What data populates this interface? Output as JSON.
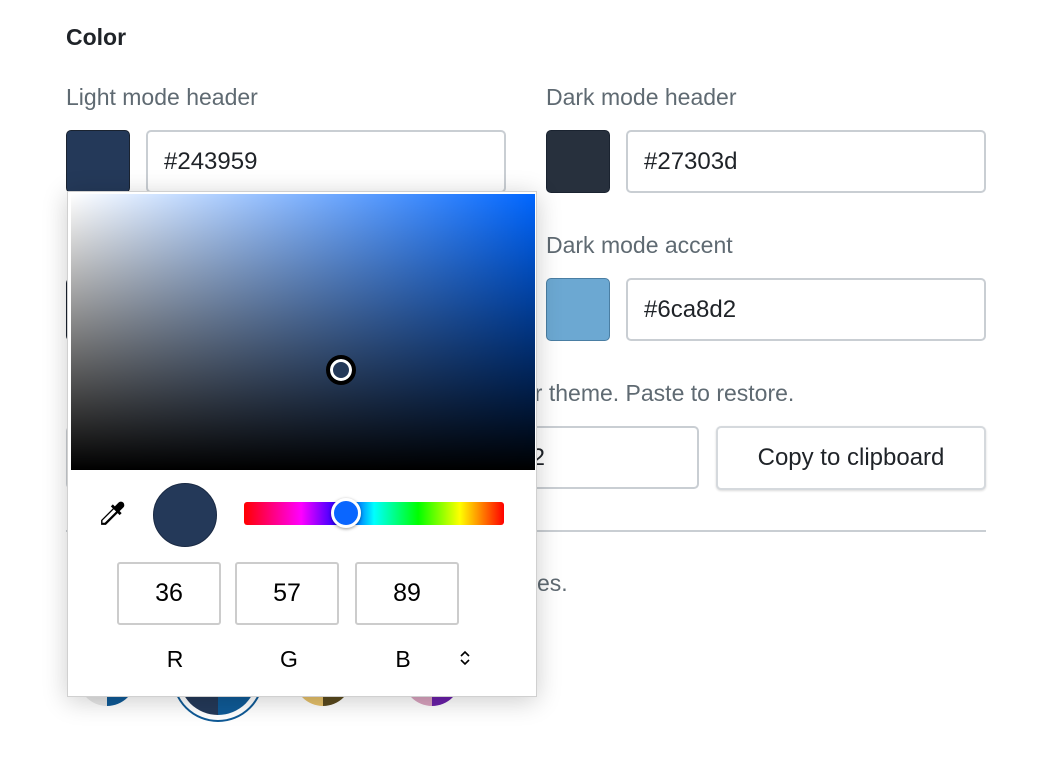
{
  "section_title": "Color",
  "light_header": {
    "label": "Light mode header",
    "value": "#243959",
    "color": "#243959"
  },
  "dark_header": {
    "label": "Dark mode header",
    "value": "#27303d",
    "color": "#27303d"
  },
  "dark_accent": {
    "label": "Dark mode accent",
    "value": "#6ca8d2",
    "color": "#6ca8d2"
  },
  "light_accent": {
    "color": "#0f5a96"
  },
  "theme_text_partial": "ur theme. Paste to restore.",
  "theme_input_partial": "2",
  "copy_button": "Copy to clipboard",
  "presets_text_partial": "es.",
  "picker": {
    "hue_color": "#0066ff",
    "selected_color": "#243959",
    "r": "36",
    "g": "57",
    "b": "89",
    "r_label": "R",
    "g_label": "G",
    "b_label": "B",
    "mode_toggle_icon": "chevron-up-down-icon",
    "eyedropper_icon": "eyedropper-icon"
  },
  "theme_presets": [
    {
      "colors": [
        "#e8e8e8",
        "#0f5a96"
      ]
    },
    {
      "colors": [
        "#243959",
        "#0f5a96"
      ],
      "selected": true
    },
    {
      "colors": [
        "#e5c06a",
        "#5a4a1e"
      ]
    },
    {
      "colors": [
        "#d9a3bf",
        "#6a1fa8"
      ]
    }
  ]
}
